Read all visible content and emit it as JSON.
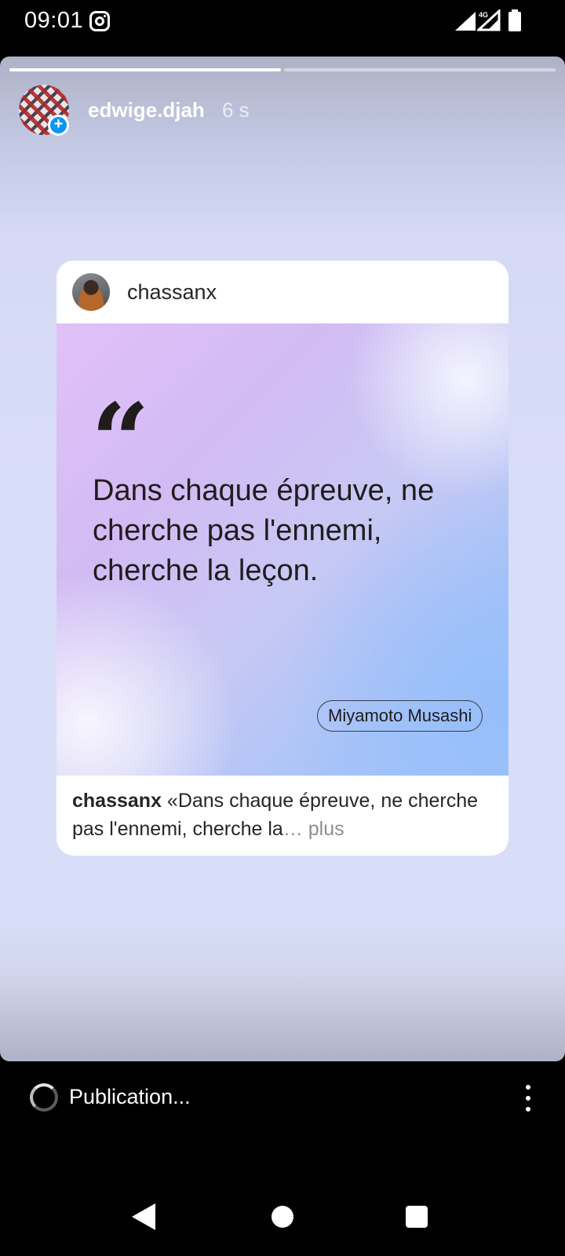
{
  "status_bar": {
    "time": "09:01",
    "network_label": "4G",
    "icons": [
      "instagram-icon",
      "signal-icon",
      "signal-4g-icon",
      "battery-icon"
    ]
  },
  "story": {
    "progress": [
      1.0,
      0.0
    ],
    "username": "edwige.djah",
    "time_ago": "6 s",
    "avatar_badge": "+"
  },
  "post": {
    "username": "chassanx",
    "quote_mark": "“",
    "quote_lines": [
      "Dans chaque épreuve, ne",
      "cherche pas l'ennemi,",
      "cherche la leçon."
    ],
    "author": "Miyamoto Musashi",
    "caption_user": "chassanx",
    "caption_text": " «Dans chaque épreuve, ne cherche pas l'ennemi, cherche la",
    "caption_more": "… plus"
  },
  "bottom_bar": {
    "status": "Publication...",
    "more_icon": "more-vertical-icon"
  },
  "nav_bar": {
    "icons": [
      "back-icon",
      "home-icon",
      "recents-icon"
    ]
  }
}
